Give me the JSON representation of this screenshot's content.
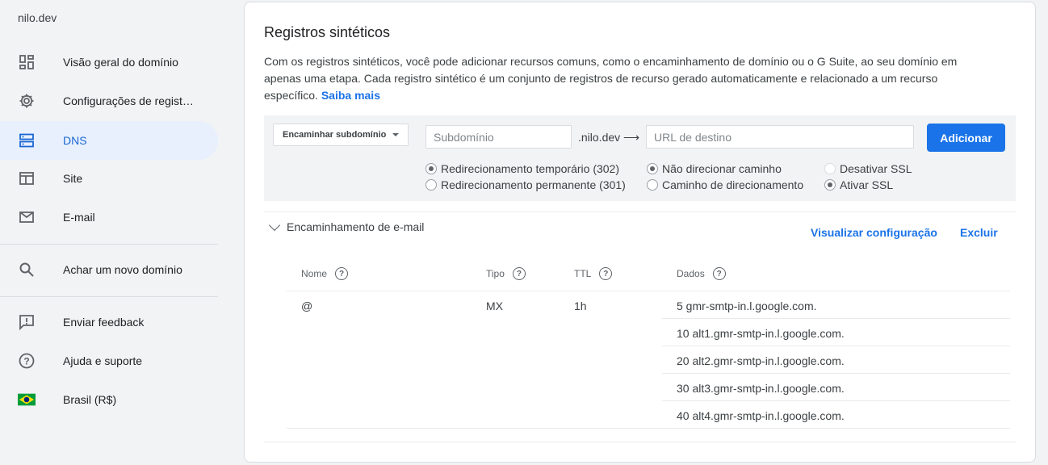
{
  "sidebar": {
    "site_name": "nilo.dev",
    "items": [
      {
        "label": "Visão geral do domínio",
        "icon": "dashboard-icon"
      },
      {
        "label": "Configurações de regist…",
        "icon": "gear-icon"
      },
      {
        "label": "DNS",
        "icon": "dns-icon",
        "active": true
      },
      {
        "label": "Site",
        "icon": "web-icon"
      },
      {
        "label": "E-mail",
        "icon": "mail-icon"
      },
      {
        "label": "Achar um novo domínio",
        "icon": "search-icon"
      },
      {
        "label": "Enviar feedback",
        "icon": "feedback-icon"
      },
      {
        "label": "Ajuda e suporte",
        "icon": "help-icon"
      },
      {
        "label": "Brasil (R$)",
        "icon": "brazil-flag-icon"
      }
    ]
  },
  "card": {
    "title": "Registros sintéticos",
    "description": "Com os registros sintéticos, você pode adicionar recursos comuns, como o encaminhamento de domínio ou o G Suite, ao seu domínio em apenas uma etapa. Cada registro sintético é um conjunto de registros de recurso gerado automaticamente e relacionado a um recurso específico.",
    "learn_more": "Saiba mais"
  },
  "form": {
    "type_select": "Encaminhar subdomínio",
    "subdomain_placeholder": "Subdomínio",
    "domain_suffix": ".nilo.dev ⟶",
    "url_placeholder": "URL de destino",
    "add_button": "Adicionar",
    "radios": {
      "temp_redirect": "Redirecionamento temporário (302)",
      "perm_redirect": "Redirecionamento permanente (301)",
      "no_path": "Não direcionar caminho",
      "path_forward": "Caminho de direcionamento",
      "ssl_off": "Desativar SSL",
      "ssl_on": "Ativar SSL"
    }
  },
  "email_forwarding": {
    "title": "Encaminhamento de e-mail",
    "view_config": "Visualizar configuração",
    "delete": "Excluir",
    "columns": {
      "name": "Nome",
      "type": "Tipo",
      "ttl": "TTL",
      "data": "Dados"
    },
    "record": {
      "name": "@",
      "type": "MX",
      "ttl": "1h",
      "data": [
        "5 gmr-smtp-in.l.google.com.",
        "10 alt1.gmr-smtp-in.l.google.com.",
        "20 alt2.gmr-smtp-in.l.google.com.",
        "30 alt3.gmr-smtp-in.l.google.com.",
        "40 alt4.gmr-smtp-in.l.google.com."
      ]
    }
  },
  "colors": {
    "accent": "#1a73e8",
    "active_bg": "#e8f0fe"
  }
}
